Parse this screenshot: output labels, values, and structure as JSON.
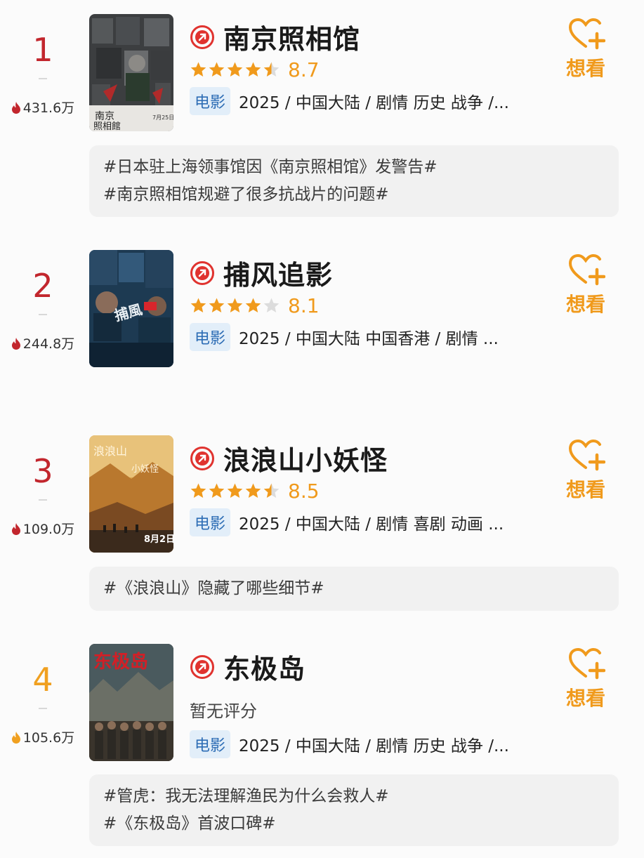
{
  "colors": {
    "rank_top": "#c2262d",
    "rank_fourth": "#f0a020",
    "accent": "#f09a1c",
    "tag_bg": "#e2eef9",
    "tag_text": "#2d6db5",
    "badge": "#e0332f"
  },
  "items": [
    {
      "rank": "1",
      "heat": "431.6万",
      "title": "南京照相馆",
      "rating": {
        "stars": 4.5,
        "score": "8.7"
      },
      "tag": "电影",
      "meta": "2025 / 中国大陆 / 剧情 历史 战争 /...",
      "want_label": "想看",
      "topics": [
        "#日本驻上海领事馆因《南京照相馆》发警告#",
        "#南京照相馆规避了很多抗战片的问题#"
      ]
    },
    {
      "rank": "2",
      "heat": "244.8万",
      "title": "捕风追影",
      "rating": {
        "stars": 4,
        "score": "8.1"
      },
      "tag": "电影",
      "meta": "2025 / 中国大陆 中国香港 / 剧情 ...",
      "want_label": "想看",
      "topics": []
    },
    {
      "rank": "3",
      "heat": "109.0万",
      "title": "浪浪山小妖怪",
      "rating": {
        "stars": 4.5,
        "score": "8.5"
      },
      "tag": "电影",
      "meta": "2025 / 中国大陆 / 剧情 喜剧 动画 ...",
      "want_label": "想看",
      "topics": [
        "#《浪浪山》隐藏了哪些细节#"
      ]
    },
    {
      "rank": "4",
      "heat": "105.6万",
      "title": "东极岛",
      "no_rating": "暂无评分",
      "tag": "电影",
      "meta": "2025 / 中国大陆 / 剧情 历史 战争 /...",
      "want_label": "想看",
      "topics": [
        "#管虎：我无法理解渔民为什么会救人#",
        "#《东极岛》首波口碑#"
      ]
    }
  ]
}
